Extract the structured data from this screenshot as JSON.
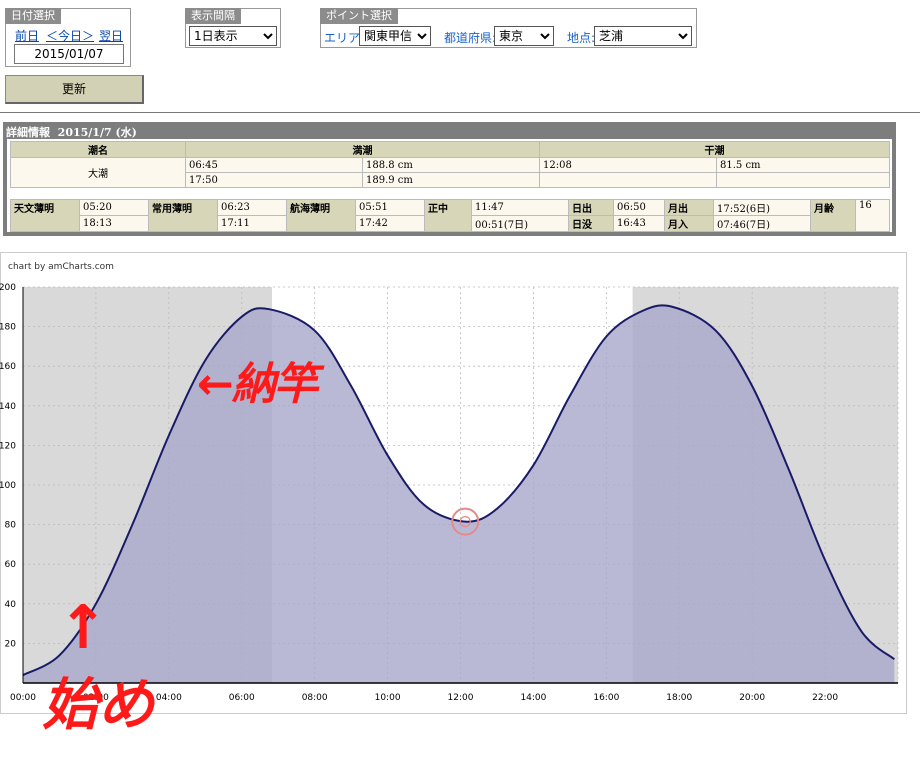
{
  "date_panel": {
    "title": "日付選択",
    "prev": "前日",
    "today": "＜今日＞",
    "next": "翌日",
    "date_value": "2015/01/07"
  },
  "interval_panel": {
    "title": "表示間隔",
    "selected": "1日表示"
  },
  "point_panel": {
    "title": "ポイント選択",
    "area_label": "エリア:",
    "area_value": "関東甲信",
    "pref_label": "都道府県:",
    "pref_value": "東京",
    "spot_label": "地点:",
    "spot_value": "芝浦"
  },
  "update_button": "更新",
  "detail": {
    "title": "詳細情報",
    "date": "2015/1/7 (水)",
    "headers": {
      "tide_name": "潮名",
      "high": "満潮",
      "low": "干潮"
    },
    "tide_name": "大潮",
    "high_tides": [
      {
        "time": "06:45",
        "level": "188.8 cm"
      },
      {
        "time": "17:50",
        "level": "189.9 cm"
      }
    ],
    "low_tides": [
      {
        "time": "12:08",
        "level": "81.5 cm"
      },
      {
        "time": "",
        "level": ""
      }
    ],
    "astro": {
      "l1": "天文薄明",
      "v1a": "05:20",
      "v1b": "18:13",
      "l2": "常用薄明",
      "v2a": "06:23",
      "v2b": "17:11",
      "l3": "航海薄明",
      "v3a": "05:51",
      "v3b": "17:42",
      "l4": "正中",
      "v4a": "11:47",
      "v4b": "00:51(7日)",
      "l5a": "日出",
      "v5a": "06:50",
      "l5b": "日没",
      "v5b": "16:43",
      "l6a": "月出",
      "v6a": "17:52(6日)",
      "l6b": "月入",
      "v6b": "07:46(7日)",
      "l7": "月齢",
      "v7": "16"
    }
  },
  "chart_credit": "chart by amCharts.com",
  "annotations": {
    "natto": "←納竿",
    "start": "始め",
    "arrow": "↑"
  },
  "chart_data": {
    "type": "area",
    "xlim": [
      0,
      24
    ],
    "ylim": [
      0,
      200
    ],
    "x_ticks": [
      "00:00",
      "02:00",
      "04:00",
      "06:00",
      "08:00",
      "10:00",
      "12:00",
      "14:00",
      "16:00",
      "18:00",
      "20:00",
      "22:00"
    ],
    "y_ticks": [
      "20",
      "40",
      "60",
      "80",
      "100",
      "120",
      "140",
      "160",
      "180",
      "200"
    ],
    "x": [
      0,
      1,
      2,
      3,
      4,
      5,
      6,
      6.75,
      8,
      9,
      10,
      11,
      12.13,
      13,
      14,
      15,
      16,
      17,
      17.83,
      19,
      20,
      21,
      22,
      23,
      23.9
    ],
    "values": [
      4,
      14,
      40,
      80,
      125,
      163,
      185,
      188.8,
      178,
      150,
      115,
      90,
      81.5,
      88,
      110,
      145,
      175,
      188,
      189.9,
      178,
      150,
      108,
      62,
      26,
      12
    ],
    "night_bands": [
      [
        0,
        6.83
      ],
      [
        16.72,
        24
      ]
    ],
    "marker": {
      "x": 12.13,
      "y": 81.5
    },
    "colors": {
      "fill": "#a8a8cc",
      "line": "#1a1a66",
      "night": "#d9d9d9",
      "marker": "#e58a8a"
    }
  }
}
